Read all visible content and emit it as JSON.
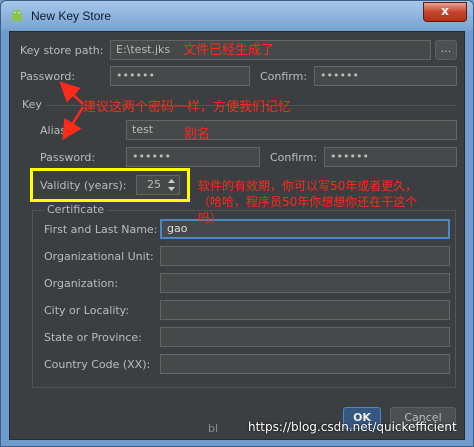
{
  "window": {
    "title": "New Key Store",
    "close_glyph": "x"
  },
  "keystore": {
    "path_label": "Key store path:",
    "path_value": "E:\\test.jks",
    "browse_label": "...",
    "password_label": "Password:",
    "password_value": "••••••",
    "confirm_label": "Confirm:",
    "confirm_value": "••••••"
  },
  "key": {
    "section_label": "Key",
    "alias_label": "Alias:",
    "alias_value": "test",
    "password_label": "Password:",
    "password_value": "••••••",
    "confirm_label": "Confirm:",
    "confirm_value": "••••••",
    "validity_label": "Validity (years):",
    "validity_value": "25"
  },
  "certificate": {
    "section_label": "Certificate",
    "fields": [
      {
        "label": "First and Last Name:",
        "value": "gao"
      },
      {
        "label": "Organizational Unit:",
        "value": ""
      },
      {
        "label": "Organization:",
        "value": ""
      },
      {
        "label": "City or Locality:",
        "value": ""
      },
      {
        "label": "State or Province:",
        "value": ""
      },
      {
        "label": "Country Code (XX):",
        "value": ""
      }
    ]
  },
  "buttons": {
    "ok": "OK",
    "cancel": "Cancel"
  },
  "annotations": {
    "path_note": "文件已经生成了",
    "password_note": "建议这两个密码一样，方便我们记忆",
    "alias_note": "别名",
    "validity_note_1": "软件的有效期，你可以写50年或者更久，",
    "validity_note_2": "（哈哈，程序员50年你想想你还在干这个",
    "validity_note_3": "吗）"
  },
  "watermark": {
    "left_fragment": "bl",
    "url": "https://blog.csdn.net/quickefficient"
  },
  "colors": {
    "annotation": "#ff2a1a",
    "highlight": "#ffff00",
    "dialog_bg": "#3c3f41",
    "focus": "#4a88c7"
  },
  "icons": {
    "title": "android-icon",
    "spinner": "up-down-arrows-icon"
  }
}
